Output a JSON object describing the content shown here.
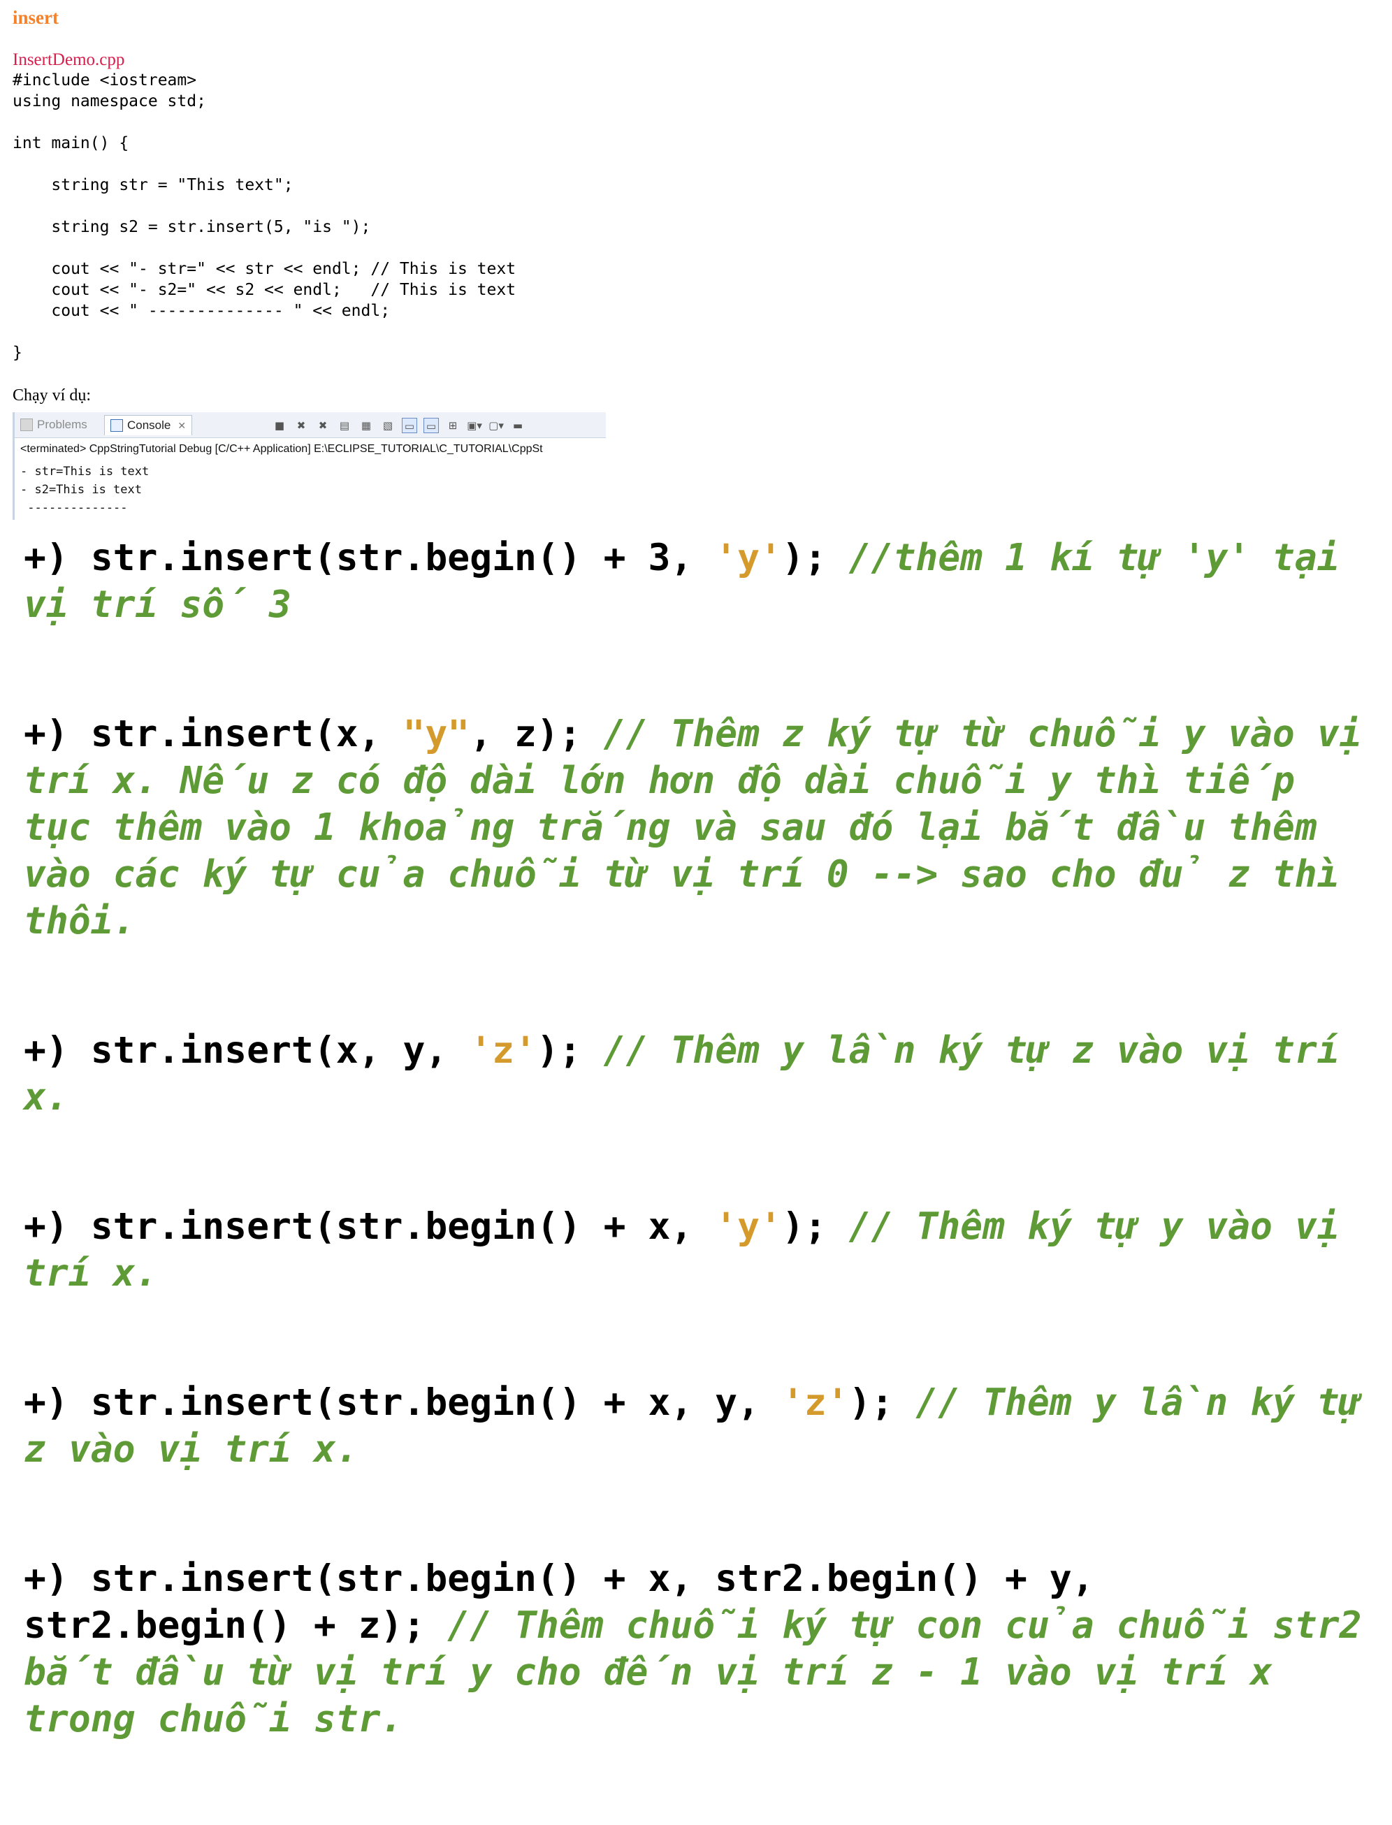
{
  "title": "insert",
  "filename": "InsertDemo.cpp",
  "code_lines": [
    "#include <iostream>",
    "using namespace std;",
    "",
    "int main() {",
    "",
    "    string str = \"This text\";",
    "",
    "    string s2 = str.insert(5, \"is \");",
    "",
    "    cout << \"- str=\" << str << endl; // This is text",
    "    cout << \"- s2=\" << s2 << endl;   // This is text",
    "    cout << \" -------------- \" << endl;",
    "",
    "}"
  ],
  "run_label": "Chạy ví dụ:",
  "console": {
    "tabs": {
      "problems": "Problems",
      "console": "Console"
    },
    "status": "<terminated> CppStringTutorial Debug [C/C++ Application] E:\\ECLIPSE_TUTORIAL\\C_TUTORIAL\\CppSt",
    "output": [
      "- str=This is text",
      "- s2=This is text",
      " --------------"
    ],
    "toolbar_icons": [
      "terminate-icon",
      "remove-launch-icon",
      "remove-all-icon",
      "clear-console-icon",
      "scroll-lock-icon",
      "word-wrap-icon",
      "show-on-stdout-icon",
      "show-on-stderr-icon",
      "pin-console-icon",
      "display-console-icon",
      "open-console-icon",
      "minimize-icon"
    ]
  },
  "notes": [
    {
      "parts": [
        {
          "t": "code",
          "text": "+) str.insert(str.begin() + 3, "
        },
        {
          "t": "lit",
          "text": "'y'"
        },
        {
          "t": "code",
          "text": "); "
        },
        {
          "t": "cmt",
          "text": "//thêm 1 kí tự 'y' tại vị trí số 3"
        }
      ]
    },
    {
      "parts": [
        {
          "t": "code",
          "text": "+) str.insert(x, "
        },
        {
          "t": "lit",
          "text": "\"y\""
        },
        {
          "t": "code",
          "text": ", z); "
        },
        {
          "t": "cmt",
          "text": "// Thêm z ký tự từ chuỗi y vào vị trí x. Nếu z có độ dài lớn hơn độ dài chuỗi y thì tiếp tục thêm vào 1 khoảng trắng và sau đó lại bắt đầu thêm vào các ký tự của chuỗi từ vị trí 0 --> sao cho đủ z thì thôi."
        }
      ]
    },
    {
      "parts": [
        {
          "t": "code",
          "text": "+) str.insert(x, y, "
        },
        {
          "t": "lit",
          "text": "'z'"
        },
        {
          "t": "code",
          "text": "); "
        },
        {
          "t": "cmt",
          "text": "// Thêm y lần ký tự z vào vị trí x."
        }
      ]
    },
    {
      "parts": [
        {
          "t": "code",
          "text": "+) str.insert(str.begin() + x, "
        },
        {
          "t": "lit",
          "text": "'y'"
        },
        {
          "t": "code",
          "text": "); "
        },
        {
          "t": "cmt",
          "text": "// Thêm ký tự y vào vị trí x."
        }
      ]
    },
    {
      "parts": [
        {
          "t": "code",
          "text": "+) str.insert(str.begin() + x, y, "
        },
        {
          "t": "lit",
          "text": "'z'"
        },
        {
          "t": "code",
          "text": "); "
        },
        {
          "t": "cmt",
          "text": "// Thêm y lần ký tự z vào vị trí x."
        }
      ]
    },
    {
      "parts": [
        {
          "t": "code",
          "text": "+) str.insert(str.begin() + x, str2.begin() + y, str2.begin() + z); "
        },
        {
          "t": "cmt",
          "text": "// Thêm chuỗi ký tự con của chuỗi str2 bắt đầu từ vị trí y cho đến vị trí z - 1 vào vị trí x trong chuỗi str."
        }
      ]
    }
  ]
}
